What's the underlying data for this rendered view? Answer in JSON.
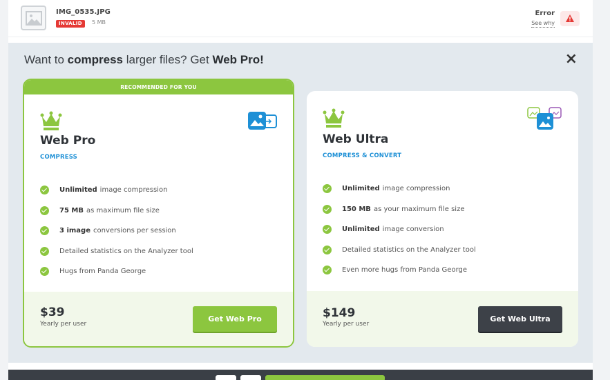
{
  "file": {
    "name": "IMG_0535.JPG",
    "badge": "INVALID",
    "size": "5 MB",
    "status": "Error",
    "see_why": "See why"
  },
  "promo": {
    "headline_pre": "Want to ",
    "headline_bold1": "compress",
    "headline_mid": " larger files? Get ",
    "headline_bold2": "Web Pro!",
    "close": "×"
  },
  "plans": {
    "pro": {
      "banner": "RECOMMENDED FOR YOU",
      "title": "Web Pro",
      "subtitle": "COMPRESS",
      "features": [
        {
          "bold": "Unlimited",
          "text": "image compression"
        },
        {
          "bold": "75 MB",
          "text": "as maximum file size"
        },
        {
          "bold": "3 image",
          "text": "conversions per session"
        },
        {
          "bold": "",
          "text": "Detailed statistics on the Analyzer tool"
        },
        {
          "bold": "",
          "text": "Hugs from Panda George"
        }
      ],
      "price": "$39",
      "period": "Yearly per user",
      "button": "Get Web Pro"
    },
    "ultra": {
      "title": "Web Ultra",
      "subtitle": "COMPRESS & CONVERT",
      "features": [
        {
          "bold": "Unlimited",
          "text": "image compression"
        },
        {
          "bold": "150 MB",
          "text": "as your maximum file size"
        },
        {
          "bold": "Unlimited",
          "text": "image conversion"
        },
        {
          "bold": "",
          "text": "Detailed statistics on the Analyzer tool"
        },
        {
          "bold": "",
          "text": "Even more hugs from Panda George"
        }
      ],
      "price": "$149",
      "period": "Yearly per user",
      "button": "Get Web Ultra"
    }
  },
  "colors": {
    "accent_green": "#8cc63f",
    "accent_blue": "#1e90d6",
    "error_red": "#e53935",
    "dark_button": "#3d4148"
  },
  "icons": [
    "image-placeholder-icon",
    "warning-icon",
    "close-icon",
    "crown-icon",
    "image-compress-icon",
    "image-convert-icon",
    "check-icon"
  ]
}
